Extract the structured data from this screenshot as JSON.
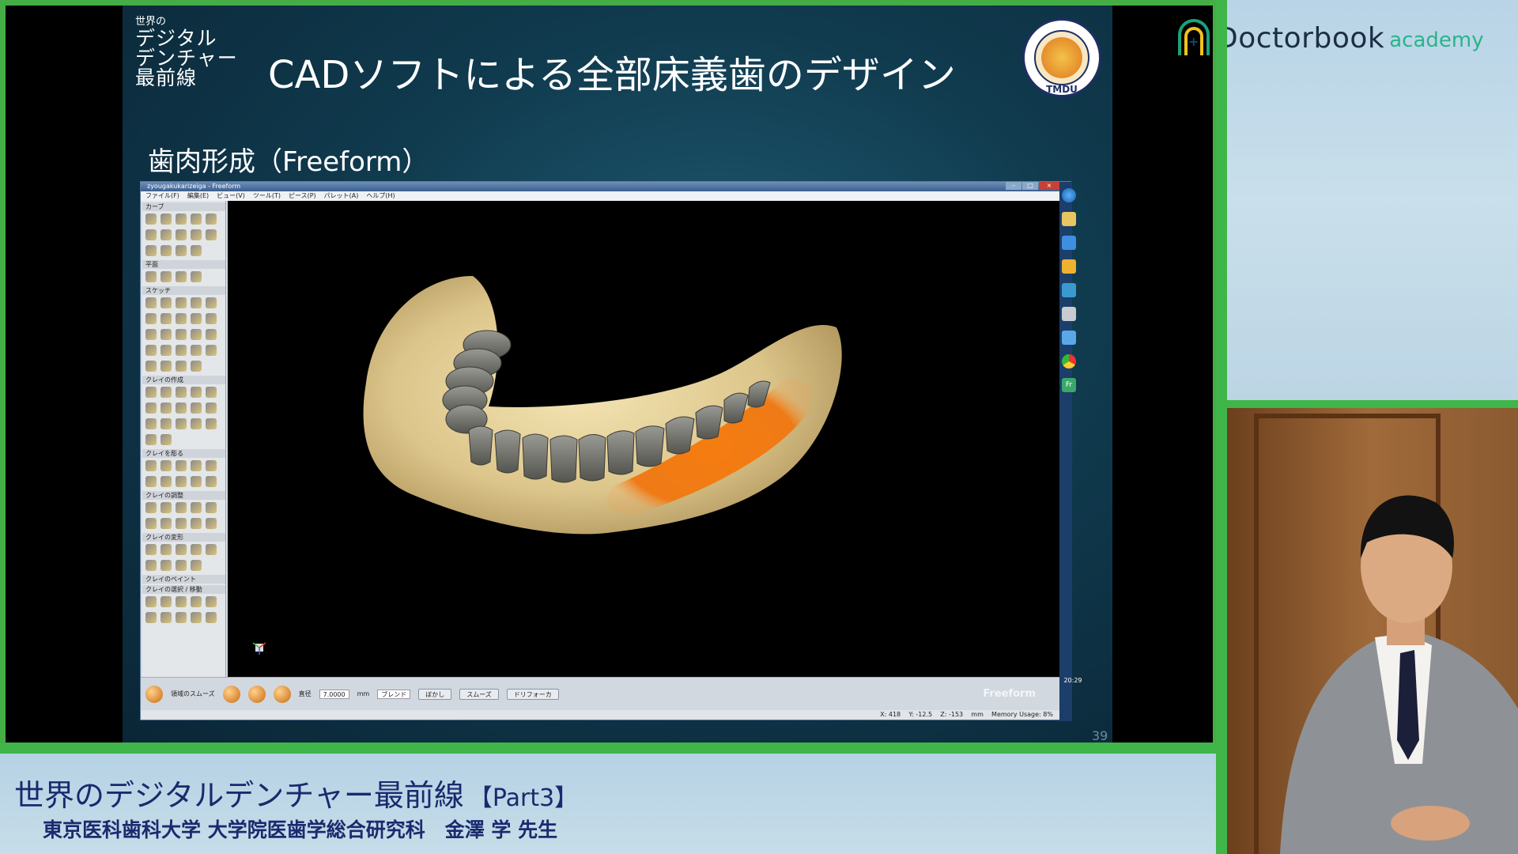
{
  "slide": {
    "series_logo_small": "世界の",
    "series_logo_lines": [
      "デジタル",
      "デンチャー",
      "最前線"
    ],
    "title": "CADソフトによる全部床義歯のデザイン",
    "subtitle": "歯肉形成（Freeform）",
    "seal_label": "TMDU",
    "slide_number": "39"
  },
  "app": {
    "window_title": "zyougakukarizeiga - Freeform",
    "window_controls": [
      "–",
      "□",
      "×"
    ],
    "menu": [
      "ファイル(F)",
      "編集(E)",
      "ビュー(V)",
      "ツール(T)",
      "ピース(P)",
      "パレット(A)",
      "ヘルプ(H)"
    ],
    "palette_sections": [
      "カーブ",
      "平面",
      "スケッチ",
      "クレイの作成",
      "クレイを彫る",
      "クレイの調整",
      "クレイの変形",
      "クレイのペイント",
      "クレイの選択 / 移動"
    ],
    "bottom_tool_label": "領域のスムーズ",
    "radius_label": "直径",
    "radius_value": "7.0000",
    "radius_unit": "mm",
    "mode_label": "ブレンド",
    "btn_blur": "ぼかし",
    "btn_smooth": "スムーズ",
    "btn_detail": "ドリフォーカ",
    "brand": "Freeform",
    "status": "X: 418    Y: -12.5    Z: -153    mm    Memory Usage: 8%",
    "clock": "20:29",
    "taskbar_active": "Fr"
  },
  "brand": {
    "name": "Doctorbook",
    "suffix": "academy"
  },
  "banner": {
    "title": "世界のデジタルデンチャー最前線",
    "part": "【Part3】",
    "speaker": "東京医科歯科大学 大学院医歯学総合研究科　金澤 学 先生"
  },
  "colors": {
    "accent_green": "#3fb54a",
    "title_navy": "#1a2a6e",
    "gum": "#e8d7a0",
    "paint": "#f07a12"
  }
}
